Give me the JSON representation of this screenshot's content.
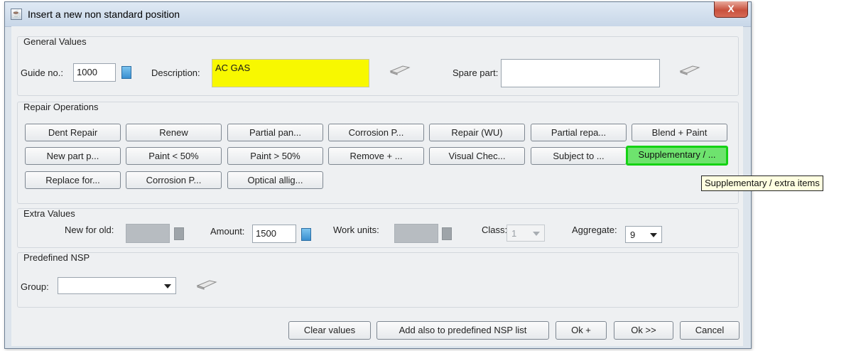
{
  "window": {
    "title": "Insert a new non standard position",
    "close_glyph": "X"
  },
  "general": {
    "title": "General Values",
    "guide_label": "Guide no.:",
    "guide_value": "1000",
    "description_label": "Description:",
    "description_value": "AC GAS",
    "spare_label": "Spare part:",
    "spare_value": ""
  },
  "repair": {
    "title": "Repair Operations",
    "row1": [
      "Dent Repair",
      "Renew",
      "Partial pan...",
      "Corrosion P...",
      "Repair (WU)",
      "Partial repa...",
      "Blend + Paint"
    ],
    "row2": [
      "New part p...",
      "Paint < 50%",
      "Paint > 50%",
      "Remove + ...",
      "Visual Chec...",
      "Subject to ...",
      "Supplementary / ..."
    ],
    "row3": [
      "Replace for...",
      "Corrosion P...",
      "Optical allig..."
    ],
    "tooltip": "Supplementary / extra items"
  },
  "extra": {
    "title": "Extra Values",
    "new_for_old_label": "New for old:",
    "amount_label": "Amount:",
    "amount_value": "1500",
    "work_units_label": "Work units:",
    "class_label": "Class:",
    "class_value": "1",
    "aggregate_label": "Aggregate:",
    "aggregate_value": "9"
  },
  "predefined": {
    "title": "Predefined NSP",
    "group_label": "Group:",
    "group_value": ""
  },
  "footer": {
    "clear": "Clear values",
    "add_predefined": "Add also to predefined NSP list",
    "ok_plus": "Ok +",
    "ok_next": "Ok >>",
    "cancel": "Cancel"
  },
  "colors": {
    "highlight": "#f8f800",
    "selected_border": "#14d214"
  }
}
